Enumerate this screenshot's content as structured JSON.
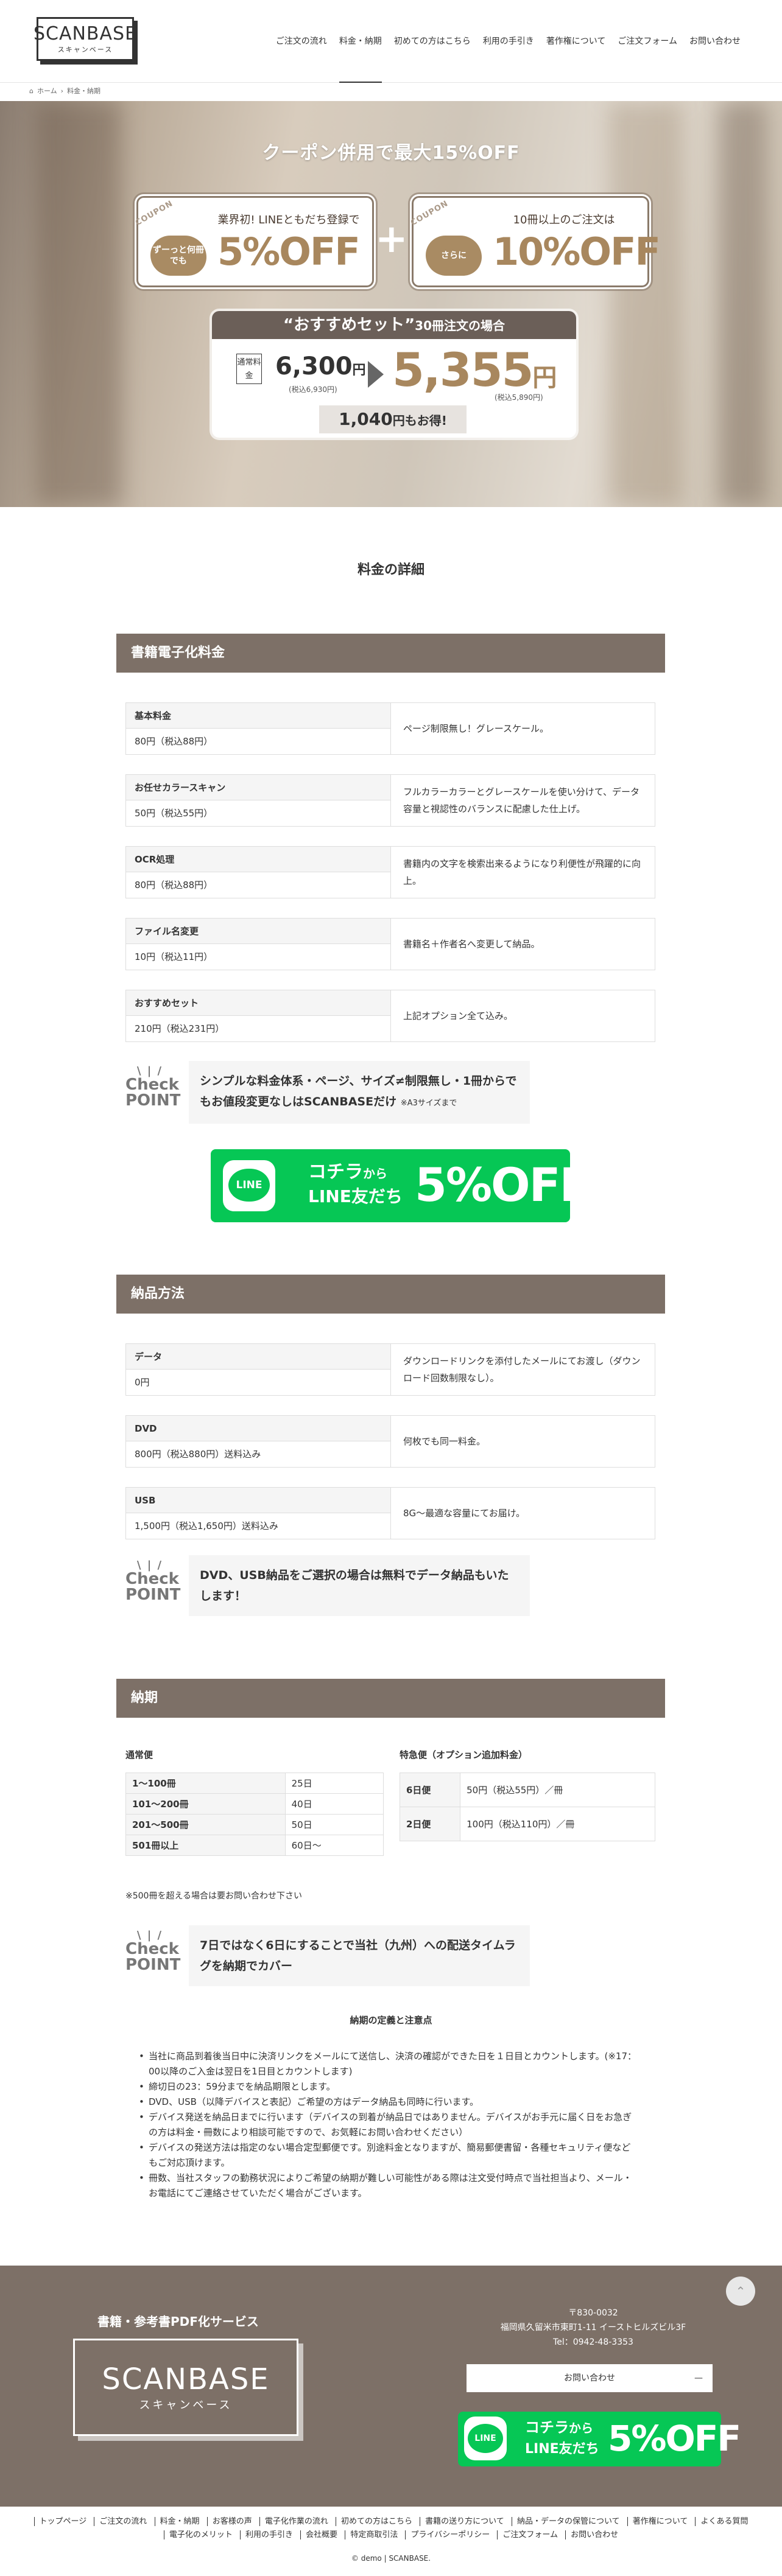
{
  "header": {
    "logo_text": "SCANBASE",
    "logo_sub": "スキャンベース",
    "nav": [
      "ご注文の流れ",
      "料金・納期",
      "初めての方はこちら",
      "利用の手引き",
      "著作権について",
      "ご注文フォーム",
      "お問い合わせ"
    ]
  },
  "breadcrumb": {
    "home": "ホーム",
    "current": "料金・納期"
  },
  "hero": {
    "title": "クーポン併用で最大15%OFF",
    "coupon1": {
      "tag": "COUPON",
      "line": "業界初! LINEともだち登録で",
      "bubble": "ずーっと何冊でも",
      "discount": "5%OFF"
    },
    "coupon2": {
      "tag": "COUPON",
      "line": "10冊以上のご注文は",
      "bubble": "さらに",
      "discount": "10%OFF"
    },
    "plus": "+",
    "set": {
      "title": "“おすすめセット”",
      "title_small": "30冊注文の場合",
      "normal_badge": "通常料金",
      "normal_price": "6,300",
      "normal_unit": "円",
      "normal_tax": "(税込6,930円)",
      "sale_price": "5,355",
      "sale_unit": "円",
      "sale_tax": "(税込5,890円)",
      "saving": "1,040",
      "saving_unit": "円もお得!"
    }
  },
  "page_title": "料金の詳細",
  "pricing": {
    "heading": "書籍電子化料金",
    "rows": [
      {
        "name": "基本料金",
        "price": "80円（税込88円）",
        "desc": "ページ制限無し！グレースケール。"
      },
      {
        "name": "お任せカラースキャン",
        "price": "50円（税込55円）",
        "desc": "フルカラーカラーとグレースケールを使い分けて、データ容量と視認性のバランスに配慮した仕上げ。"
      },
      {
        "name": "OCR処理",
        "price": "80円（税込88円）",
        "desc": "書籍内の文字を検索出来るようになり利便性が飛躍的に向上。"
      },
      {
        "name": "ファイル名変更",
        "price": "10円（税込11円）",
        "desc": "書籍名＋作者名へ変更して納品。"
      },
      {
        "name": "おすすめセット",
        "price": "210円（税込231円）",
        "desc": "上記オプション全て込み。"
      }
    ],
    "check": {
      "label1": "Check",
      "label2": "POINT",
      "text": "シンプルな料金体系・ページ、サイズ≠制限無し・1冊からでもお値段変更なしはSCANBASEだけ",
      "note": "※A3サイズまで"
    }
  },
  "line_banner": {
    "logo": "LINE",
    "k1": "コチラ",
    "k1s": "から",
    "k2": "LINE友だち",
    "off": "5%OFF"
  },
  "delivery": {
    "heading": "納品方法",
    "rows": [
      {
        "name": "データ",
        "price": "0円",
        "desc": "ダウンロードリンクを添付したメールにてお渡し（ダウンロード回数制限なし）。"
      },
      {
        "name": "DVD",
        "price": "800円（税込880円）送料込み",
        "desc": "何枚でも同一料金。"
      },
      {
        "name": "USB",
        "price": "1,500円（税込1,650円）送料込み",
        "desc": "8G〜最適な容量にてお届け。"
      }
    ],
    "check": {
      "label1": "Check",
      "label2": "POINT",
      "text": "DVD、USB納品をご選択の場合は無料でデータ納品もいたします！"
    }
  },
  "schedule": {
    "heading": "納期",
    "normal_label": "通常便",
    "normal_rows": [
      [
        "1〜100冊",
        "25日"
      ],
      [
        "101〜200冊",
        "40日"
      ],
      [
        "201〜500冊",
        "50日"
      ],
      [
        "501冊以上",
        "60日〜"
      ]
    ],
    "normal_note": "※500冊を超える場合は要お問い合わせ下さい",
    "express_label": "特急便（オプション追加料金）",
    "express_rows": [
      [
        "6日便",
        "50円（税込55円）／冊"
      ],
      [
        "2日便",
        "100円（税込110円）／冊"
      ]
    ],
    "check": {
      "label1": "Check",
      "label2": "POINT",
      "text": "7日ではなく6日にすることで当社（九州）への配送タイムラグを納期でカバー"
    },
    "notes_title": "納期の定義と注意点",
    "notes": [
      "当社に商品到着後当日中に決済リンクをメールにて送信し、決済の確認ができた日を１日目とカウントします。(※17：00以降のご入金は翌日を1日目とカウントします)",
      "締切日の23：59分までを納品期限とします。",
      "DVD、USB（以降デバイスと表記）ご希望の方はデータ納品も同時に行います。",
      "デバイス発送を納品日までに行います（デバイスの到着が納品日ではありません。デバイスがお手元に届く日をお急ぎの方は料金・冊数により相談可能ですので、お気軽にお問い合わせください）",
      "デバイスの発送方法は指定のない場合定型郵便です。別途料金となりますが、簡易郵便書留・各種セキュリティ便などもご対応頂けます。",
      "冊数、当社スタッフの勤務状況によりご希望の納期が難しい可能性がある際は注文受付時点で当社担当より、メール・お電話にてご連絡させていただく場合がございます。"
    ]
  },
  "footer": {
    "service": "書籍・参考書PDF化サービス",
    "logo_text": "SCANBASE",
    "logo_sub": "スキャンベース",
    "postal": "〒830-0032",
    "address": "福岡県久留米市東町1-11 イーストヒルズビル3F",
    "tel": "Tel：0942-48-3353",
    "contact_btn": "お問い合わせ",
    "links": [
      "トップページ",
      "ご注文の流れ",
      "料金・納期",
      "お客様の声",
      "電子化作業の流れ",
      "初めての方はこちら",
      "書籍の送り方について",
      "納品・データの保管について",
      "著作権について",
      "よくある質問",
      "電子化のメリット",
      "利用の手引き",
      "会社概要",
      "特定商取引法",
      "プライバシーポリシー",
      "ご注文フォーム",
      "お問い合わせ"
    ],
    "copyright": "© demo | SCANBASE."
  },
  "colors": {
    "section_bg": "#7d7067",
    "accent_gold": "#a8875e",
    "line_green": "#06c755"
  }
}
